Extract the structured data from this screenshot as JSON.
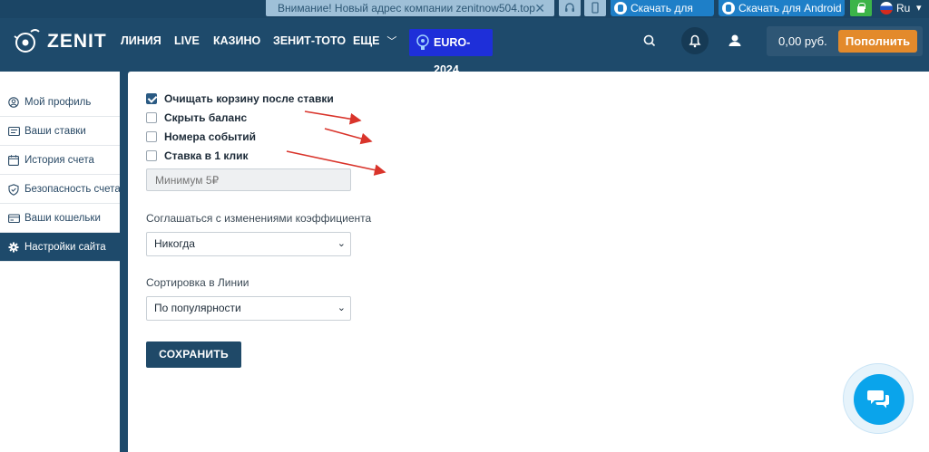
{
  "topbar": {
    "notice": "Внимание! Новый адрес компании zenitnow504.top",
    "ios_label": "Скачать для iOS",
    "android_label": "Скачать для Android",
    "language": "Ru"
  },
  "header": {
    "logo_text": "ZENIT",
    "nav": [
      "ЛИНИЯ",
      "LIVE",
      "КАЗИНО",
      "ЗЕНИТ-ТОТО",
      "ЕЩЕ"
    ],
    "euro": "EURO-2024",
    "balance": "0,00 руб.",
    "deposit_label": "Пополнить"
  },
  "sidebar": {
    "items": [
      {
        "label": "Мой профиль",
        "icon": "user-circle-icon"
      },
      {
        "label": "Ваши ставки",
        "icon": "list-icon"
      },
      {
        "label": "История счета",
        "icon": "calendar-icon"
      },
      {
        "label": "Безопасность счета",
        "icon": "shield-icon"
      },
      {
        "label": "Ваши кошельки",
        "icon": "wallet-icon"
      },
      {
        "label": "Настройки сайта",
        "icon": "gear-icon",
        "active": true
      }
    ]
  },
  "settings": {
    "checkboxes": [
      {
        "label": "Очищать корзину после ставки",
        "checked": true
      },
      {
        "label": "Скрыть баланс",
        "checked": false
      },
      {
        "label": "Номера событий",
        "checked": false
      },
      {
        "label": "Ставка в 1 клик",
        "checked": false
      }
    ],
    "min_placeholder": "Минимум 5₽",
    "odds_label": "Соглашаться с изменениями коэффициента",
    "odds_value": "Никогда",
    "sort_label": "Сортировка в Линии",
    "sort_value": "По популярности",
    "save_label": "СОХРАНИТЬ"
  },
  "colors": {
    "header_bg": "#1e4a6b",
    "accent_orange": "#e38a2b",
    "euro_blue": "#1e2fd9",
    "store_blue": "#1e7fc8",
    "chat_blue": "#0aa4eb",
    "arrow_red": "#d9342b"
  }
}
